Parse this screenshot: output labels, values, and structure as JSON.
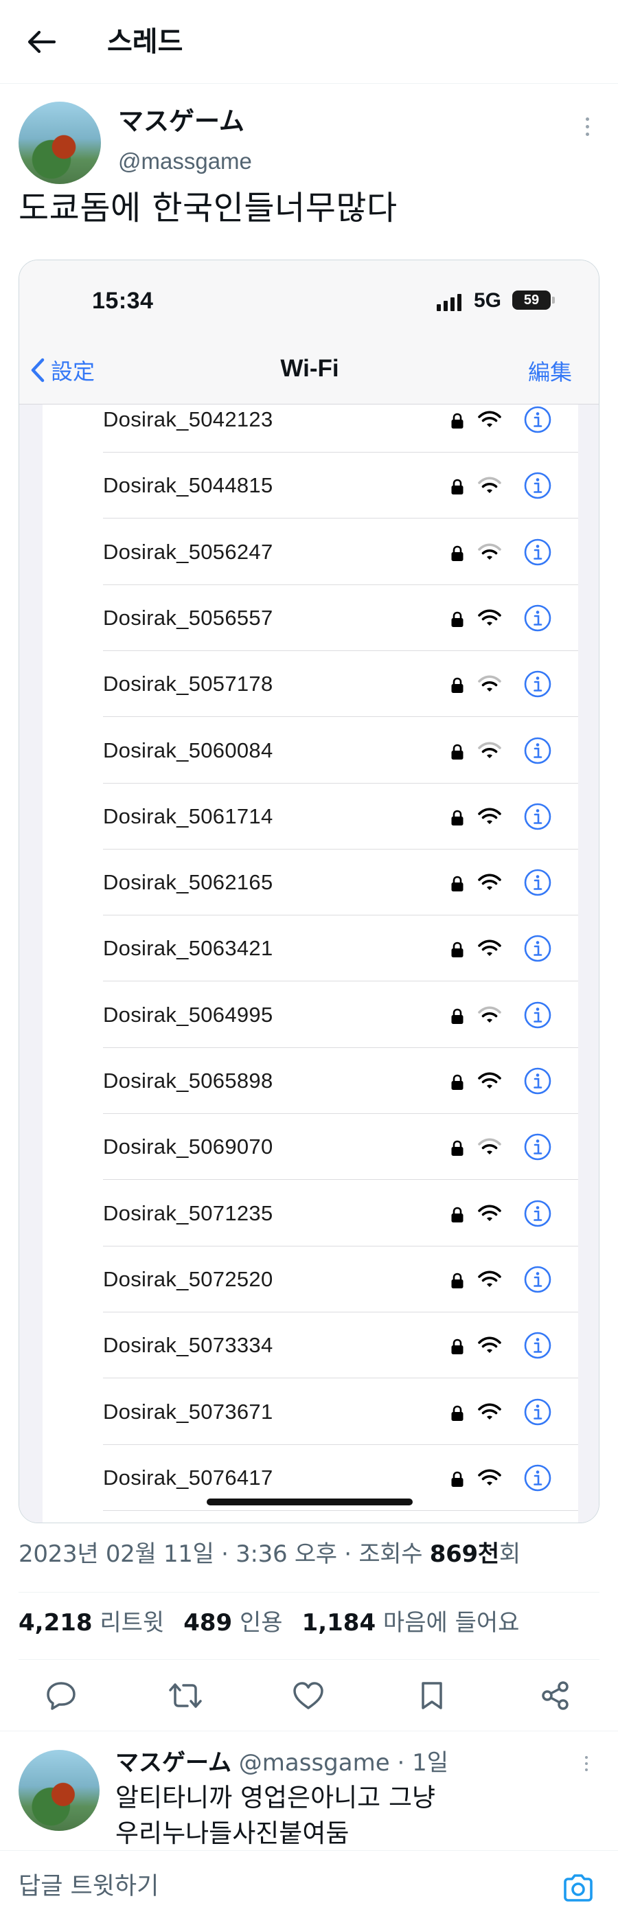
{
  "header": {
    "title": "스레드",
    "back_icon": "arrow-left-icon"
  },
  "author": {
    "display_name": "マスゲーム",
    "handle": "@massgame"
  },
  "tweet": {
    "text": "도쿄돔에 한국인들너무많다"
  },
  "phone_status": {
    "time": "15:34",
    "network": "5G",
    "battery": "59"
  },
  "wifi_nav": {
    "back_label": "設定",
    "title": "Wi-Fi",
    "edit_label": "編集"
  },
  "wifi_networks": [
    {
      "name": "Dosirak_5042123",
      "signal": 3
    },
    {
      "name": "Dosirak_5044815",
      "signal": 2
    },
    {
      "name": "Dosirak_5056247",
      "signal": 2
    },
    {
      "name": "Dosirak_5056557",
      "signal": 3
    },
    {
      "name": "Dosirak_5057178",
      "signal": 2
    },
    {
      "name": "Dosirak_5060084",
      "signal": 2
    },
    {
      "name": "Dosirak_5061714",
      "signal": 3
    },
    {
      "name": "Dosirak_5062165",
      "signal": 3
    },
    {
      "name": "Dosirak_5063421",
      "signal": 3
    },
    {
      "name": "Dosirak_5064995",
      "signal": 2
    },
    {
      "name": "Dosirak_5065898",
      "signal": 3
    },
    {
      "name": "Dosirak_5069070",
      "signal": 2
    },
    {
      "name": "Dosirak_5071235",
      "signal": 3
    },
    {
      "name": "Dosirak_5072520",
      "signal": 3
    },
    {
      "name": "Dosirak_5073334",
      "signal": 3
    },
    {
      "name": "Dosirak_5073671",
      "signal": 3
    },
    {
      "name": "Dosirak_5076417",
      "signal": 3
    }
  ],
  "meta": {
    "date": "2023년 02월 11일",
    "time": "3:36 오후",
    "views_label": "조회수",
    "views_value": "869천",
    "views_suffix": "회",
    "separator": " · "
  },
  "stats": {
    "retweets": "4,218",
    "retweets_label": "리트윗",
    "quotes": "489",
    "quotes_label": "인용",
    "likes": "1,184",
    "likes_label": "마음에 들어요"
  },
  "actions": [
    "reply-icon",
    "retweet-icon",
    "like-icon",
    "bookmark-icon",
    "share-icon"
  ],
  "reply": {
    "display_name": "マスゲーム",
    "handle": "@massgame",
    "time": "1일",
    "line1": "알티타니까 영업은아니고 그냥",
    "line2": "우리누나들사진붙여둠"
  },
  "composer": {
    "placeholder": "답글 트윗하기"
  },
  "colors": {
    "ios_blue": "#3478f6",
    "muted": "#536471",
    "text": "#0f1419",
    "twitter_blue": "#1d9bf0"
  }
}
